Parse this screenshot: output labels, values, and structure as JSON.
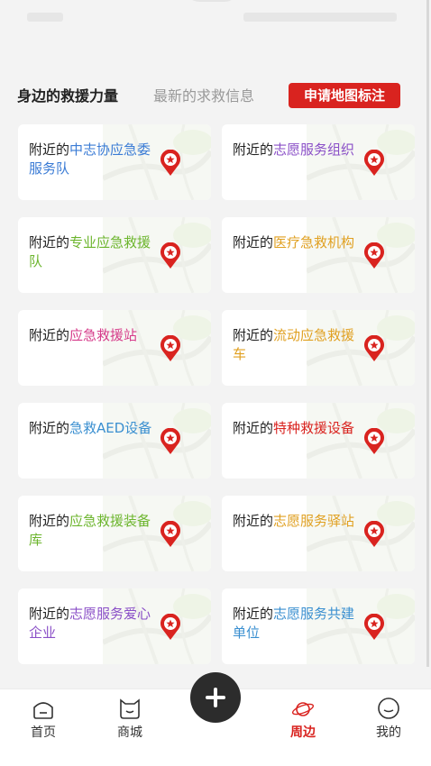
{
  "tabs": {
    "active": "身边的救援力量",
    "inactive": "最新的求救信息",
    "apply_button": "申请地图标注"
  },
  "colors": {
    "accent": "#d9231f",
    "pin": "#d9231f"
  },
  "cards": [
    {
      "prefix": "附近的",
      "highlight": "中志协应急委服务队",
      "color": "#3a7bd5"
    },
    {
      "prefix": "附近的",
      "highlight": "志愿服务组织",
      "color": "#8a4fc7"
    },
    {
      "prefix": "附近的",
      "highlight": "专业应急救援队",
      "color": "#6cb52d"
    },
    {
      "prefix": "附近的",
      "highlight": "医疗急救机构",
      "color": "#e0a021"
    },
    {
      "prefix": "附近的",
      "highlight": "应急救援站",
      "color": "#d63b8a"
    },
    {
      "prefix": "附近的",
      "highlight": "流动应急救援车",
      "color": "#e0a021"
    },
    {
      "prefix": "附近的",
      "highlight": "急救AED设备",
      "color": "#3a8fd0"
    },
    {
      "prefix": "附近的",
      "highlight": "特种救援设备",
      "color": "#d9231f"
    },
    {
      "prefix": "附近的",
      "highlight": "应急救援装备库",
      "color": "#6cb52d"
    },
    {
      "prefix": "附近的",
      "highlight": "志愿服务驿站",
      "color": "#e0a021"
    },
    {
      "prefix": "附近的",
      "highlight": "志愿服务爱心企业",
      "color": "#8a4fc7"
    },
    {
      "prefix": "附近的",
      "highlight": "志愿服务共建单位",
      "color": "#3a8fd0"
    }
  ],
  "nav": [
    {
      "label": "首页",
      "icon": "home-icon",
      "active": false
    },
    {
      "label": "商城",
      "icon": "shop-icon",
      "active": false
    },
    {
      "label": "周边",
      "icon": "planet-icon",
      "active": true
    },
    {
      "label": "我的",
      "icon": "profile-icon",
      "active": false
    }
  ],
  "fab": {
    "icon": "plus-icon"
  }
}
